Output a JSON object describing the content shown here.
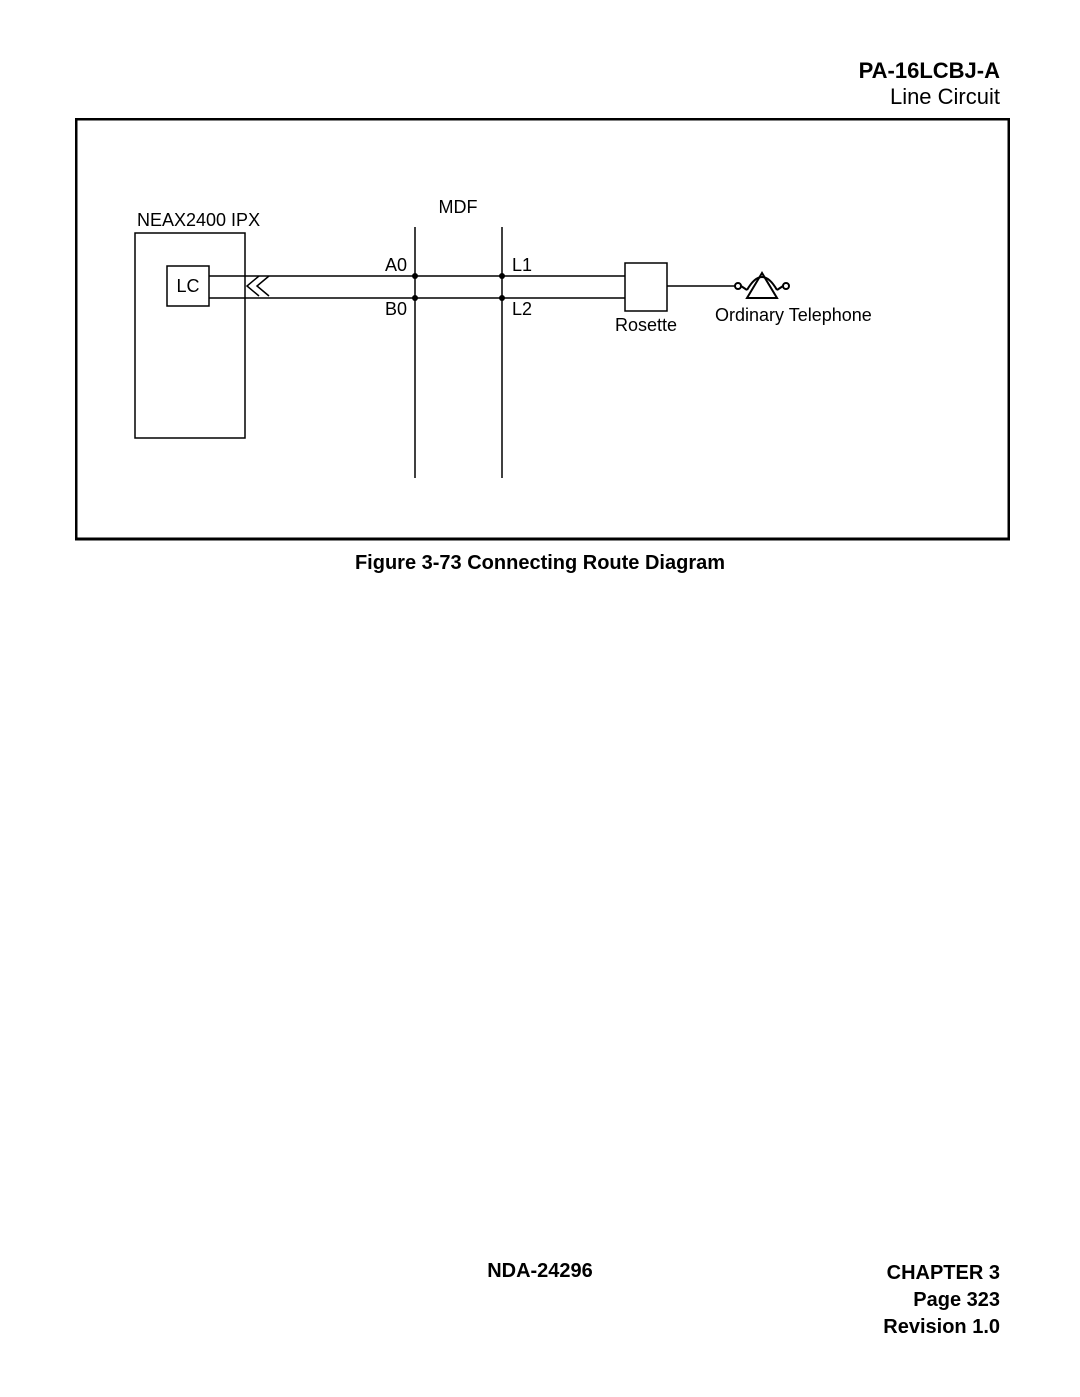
{
  "header": {
    "title": "PA-16LCBJ-A",
    "subtitle": "Line Circuit"
  },
  "diagram": {
    "system_label": "NEAX2400 IPX",
    "lc_label": "LC",
    "mdf_label": "MDF",
    "line_labels": {
      "a0": "A0",
      "b0": "B0",
      "l1": "L1",
      "l2": "L2"
    },
    "rosette_label": "Rosette",
    "telephone_label": "Ordinary Telephone"
  },
  "caption": "Figure 3-73   Connecting Route Diagram",
  "footer": {
    "doc": "NDA-24296",
    "chapter": "CHAPTER 3",
    "page": "Page 323",
    "revision": "Revision 1.0"
  }
}
